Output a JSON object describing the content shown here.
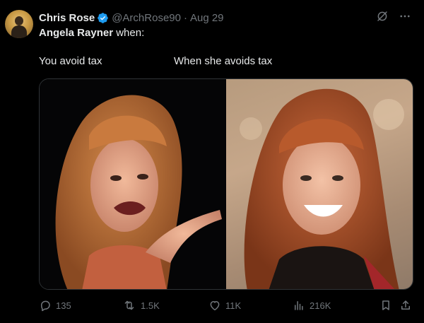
{
  "tweet": {
    "author_name": "Chris Rose",
    "handle": "@ArchRose90",
    "separator": "·",
    "date": "Aug 29",
    "mention": "Angela Rayner",
    "text_after_mention": "when:"
  },
  "captions": {
    "left": "You avoid tax",
    "right": "When she avoids tax"
  },
  "metrics": {
    "replies": "135",
    "reposts": "1.5K",
    "likes": "11K",
    "views": "216K"
  },
  "colors": {
    "background": "#000000",
    "text": "#e7e9ea",
    "muted": "#71767b",
    "verified": "#1d9bf0"
  },
  "icons": [
    "verified-icon",
    "grok-icon",
    "more-icon",
    "reply-icon",
    "repost-icon",
    "like-icon",
    "views-icon",
    "bookmark-icon",
    "share-icon"
  ]
}
